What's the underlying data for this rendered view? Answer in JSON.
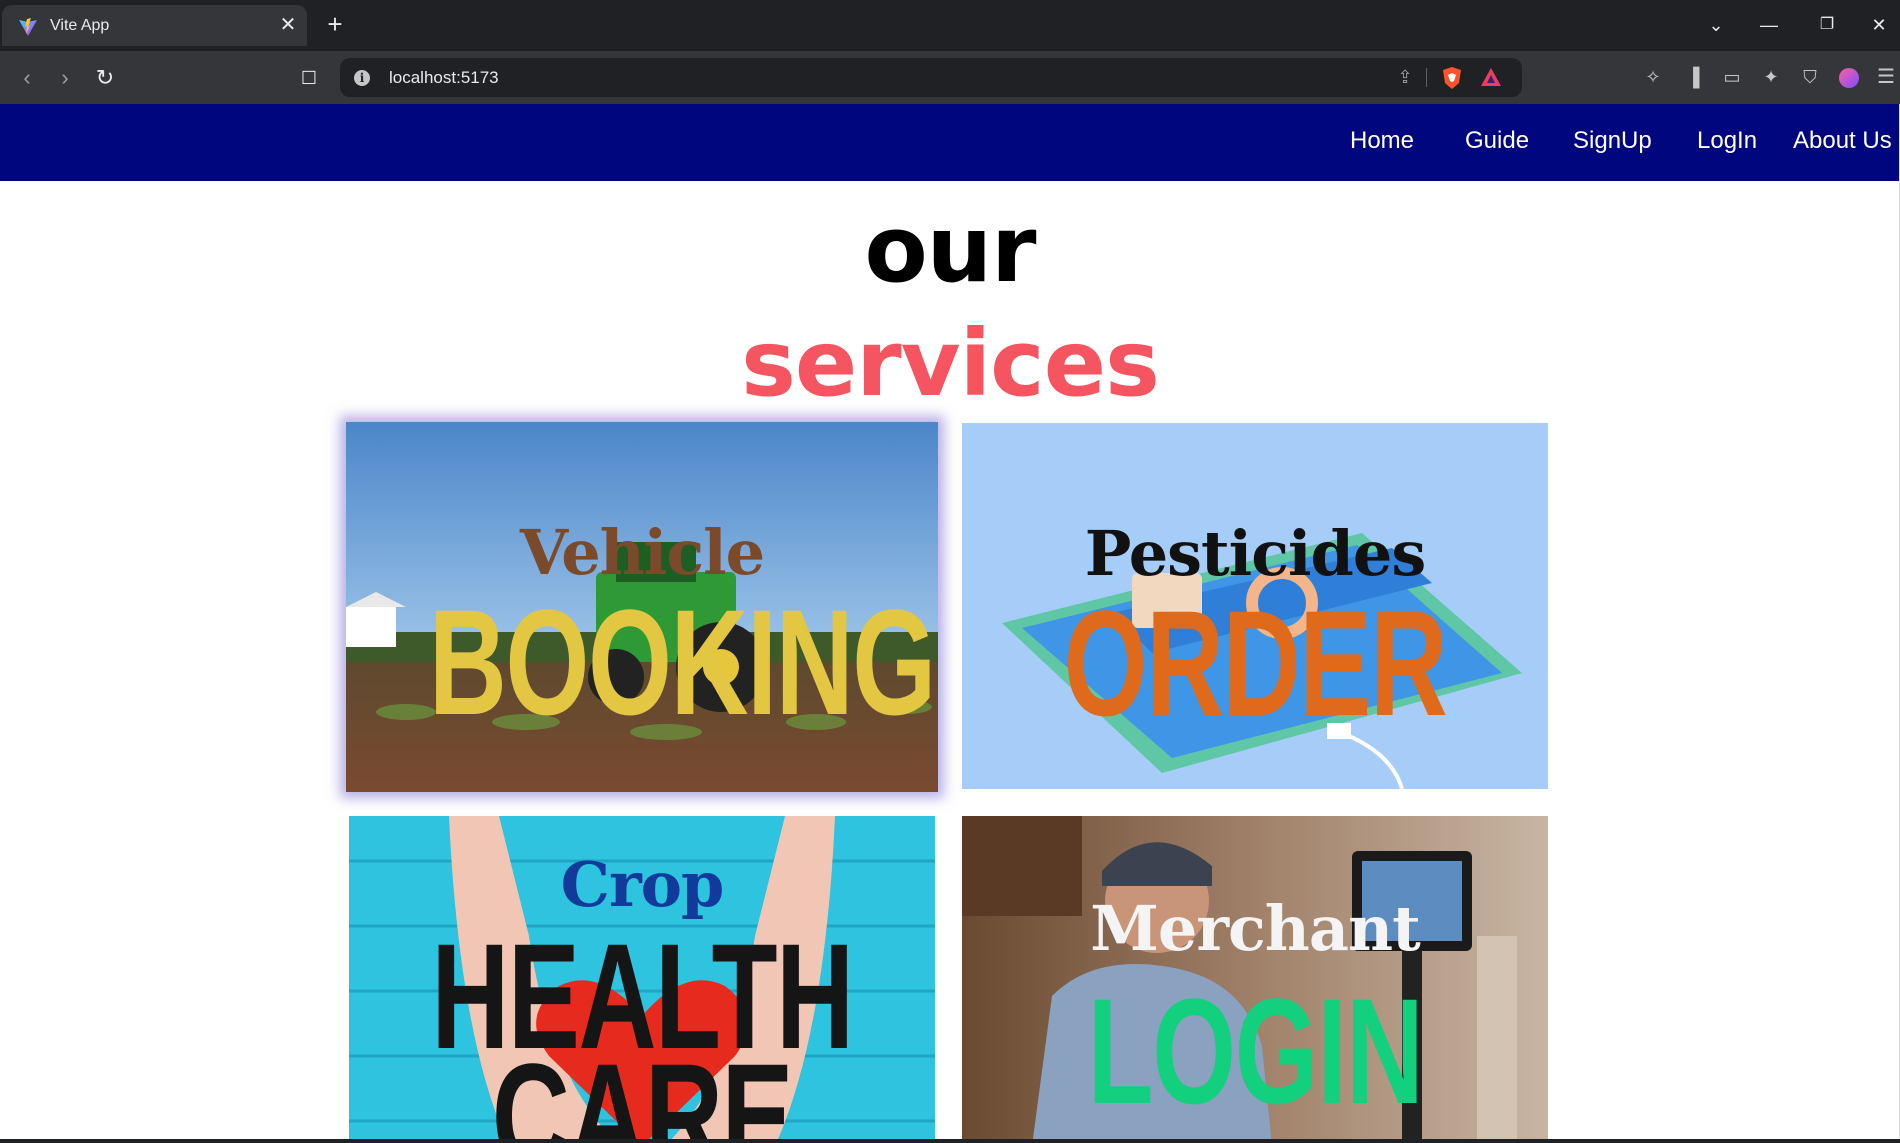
{
  "browser": {
    "tab_title": "Vite App",
    "url": "localhost:5173",
    "icons": [
      "vite-favicon",
      "close-icon",
      "plus-icon",
      "chevron-down-icon",
      "minimize-icon",
      "restore-icon",
      "close-window-icon",
      "back-icon",
      "forward-icon",
      "reload-icon",
      "bookmark-icon",
      "info-icon",
      "share-icon",
      "brave-shield-icon",
      "brave-rewards-icon",
      "extensions-icon",
      "sidebar-icon",
      "wallet-icon",
      "leo-ai-icon",
      "vpn-icon",
      "profile-icon",
      "menu-icon"
    ]
  },
  "nav": {
    "background": "#00067e",
    "links": [
      "Home",
      "Guide",
      "SignUp",
      "LogIn",
      "About Us"
    ]
  },
  "heading": {
    "line1": "our",
    "line2": "services",
    "line2_color": "#f55560"
  },
  "services": [
    {
      "top": "Vehicle",
      "big": "BOOKING",
      "top_color": "#7a4a2a",
      "big_color": "#e3c743",
      "image": "tractor in field"
    },
    {
      "top": "Pesticides",
      "big": "ORDER",
      "top_color": "#111111",
      "big_color": "#e06a1c",
      "image": "phone conveyor illustration"
    },
    {
      "top": "Crop",
      "big": "HEALTH",
      "big2": "CARE",
      "top_color": "#123a9a",
      "big_color": "#151515",
      "image": "hands holding heart"
    },
    {
      "top": "Merchant",
      "big": "LOGIN",
      "top_color": "#f4f4f4",
      "big_color": "#12d07e",
      "image": "merchant at register"
    }
  ]
}
